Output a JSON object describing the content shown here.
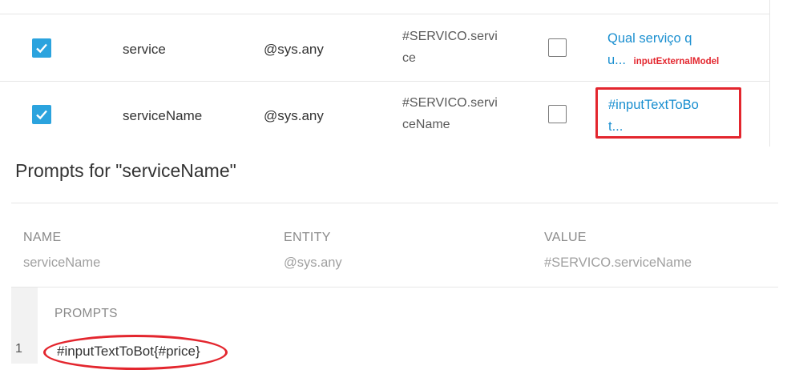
{
  "table": {
    "rows": [
      {
        "required": true,
        "name": "service",
        "entity": "@sys.any",
        "value_line1": "#SERVICO.servi",
        "value_line2": "ce",
        "is_list": false,
        "prompt_line1": "Qual serviço q",
        "prompt_line2": "u...",
        "annotation": "inputExternalModel"
      },
      {
        "required": true,
        "name": "serviceName",
        "entity": "@sys.any",
        "value_line1": "#SERVICO.servi",
        "value_line2": "ceName",
        "is_list": false,
        "prompt_line1": "#inputTextToBo",
        "prompt_line2": "t..."
      }
    ]
  },
  "prompts_panel": {
    "title": "Prompts for \"serviceName\"",
    "headers": {
      "name": "NAME",
      "entity": "ENTITY",
      "value": "VALUE"
    },
    "param": {
      "name": "serviceName",
      "entity": "@sys.any",
      "value": "#SERVICO.serviceName"
    },
    "prompts_header": "PROMPTS",
    "prompts": [
      {
        "index": "1",
        "text": "#inputTextToBot{#price}"
      }
    ]
  },
  "colors": {
    "accent": "#2ba3de",
    "link": "#1a8fd0",
    "annotation_red": "#e3262e"
  },
  "icons": {
    "checkbox_checked": "checkmark-icon"
  }
}
